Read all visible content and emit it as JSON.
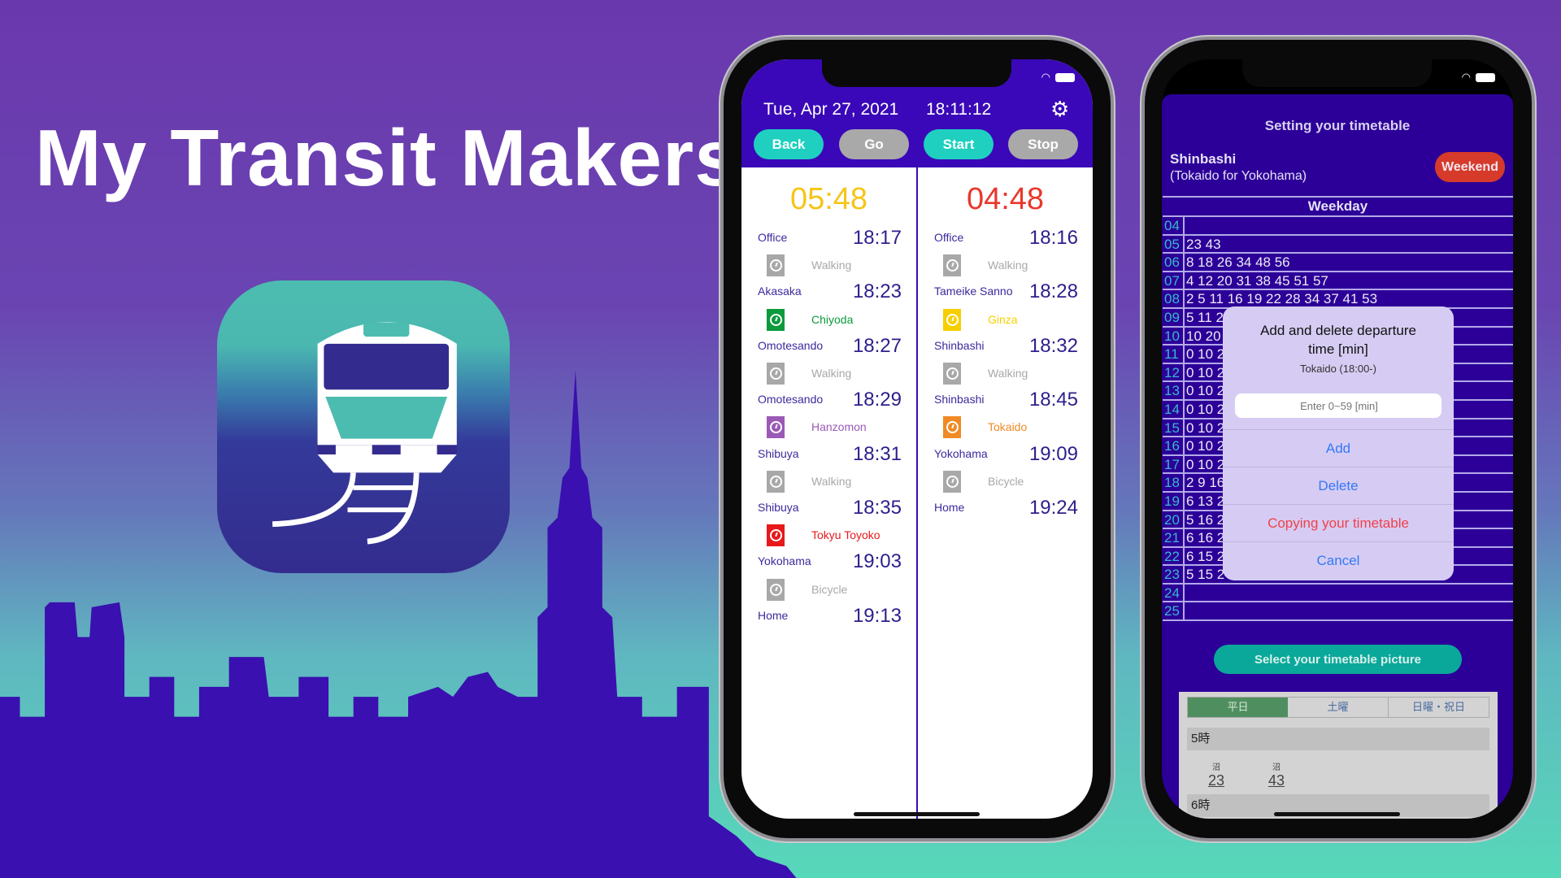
{
  "title": "My Transit Makers",
  "colors": {
    "skyline": "#3a10b0",
    "header_purple": "#3a08b8",
    "accent_teal": "#1fd0c0",
    "weekend_red": "#d63a2a"
  },
  "left_phone": {
    "date": "Tue, Apr 27, 2021",
    "clock": "18:11:12",
    "settings_icon": "gear-icon",
    "buttons": {
      "back": "Back",
      "go": "Go",
      "start": "Start",
      "stop": "Stop"
    },
    "columns": [
      {
        "countdown": "05:48",
        "countdown_color": "#f5c518",
        "items": [
          {
            "station": "Office",
            "time": "18:17"
          },
          {
            "mode": "Walking",
            "color": "#a8a8a8"
          },
          {
            "station": "Akasaka",
            "time": "18:23"
          },
          {
            "mode": "Chiyoda",
            "color": "#0b9a3c"
          },
          {
            "station": "Omotesando",
            "time": "18:27"
          },
          {
            "mode": "Walking",
            "color": "#a8a8a8"
          },
          {
            "station": "Omotesando",
            "time": "18:29"
          },
          {
            "mode": "Hanzomon",
            "color": "#9b59b6"
          },
          {
            "station": "Shibuya",
            "time": "18:31"
          },
          {
            "mode": "Walking",
            "color": "#a8a8a8"
          },
          {
            "station": "Shibuya",
            "time": "18:35"
          },
          {
            "mode": "Tokyu Toyoko",
            "color": "#e8191b"
          },
          {
            "station": "Yokohama",
            "time": "19:03"
          },
          {
            "mode": "Bicycle",
            "color": "#a8a8a8"
          },
          {
            "station": "Home",
            "time": "19:13"
          }
        ]
      },
      {
        "countdown": "04:48",
        "countdown_color": "#e8382c",
        "items": [
          {
            "station": "Office",
            "time": "18:16"
          },
          {
            "mode": "Walking",
            "color": "#a8a8a8"
          },
          {
            "station": "Tameike Sanno",
            "time": "18:28"
          },
          {
            "mode": "Ginza",
            "color": "#f7cf00"
          },
          {
            "station": "Shinbashi",
            "time": "18:32"
          },
          {
            "mode": "Walking",
            "color": "#a8a8a8"
          },
          {
            "station": "Shinbashi",
            "time": "18:45"
          },
          {
            "mode": "Tokaido",
            "color": "#f08a24"
          },
          {
            "station": "Yokohama",
            "time": "19:09"
          },
          {
            "mode": "Bicycle",
            "color": "#a8a8a8"
          },
          {
            "station": "Home",
            "time": "19:24"
          }
        ]
      }
    ]
  },
  "right_phone": {
    "heading": "Setting your timetable",
    "station": "Shinbashi",
    "line": "(Tokaido for Yokohama)",
    "weekend_button": "Weekend",
    "table_header": "Weekday",
    "rows": [
      {
        "hour": "04",
        "minutes": ""
      },
      {
        "hour": "05",
        "minutes": "23 43"
      },
      {
        "hour": "06",
        "minutes": "8 18 26 34 48 56"
      },
      {
        "hour": "07",
        "minutes": "4 12 20 31 38 45 51 57"
      },
      {
        "hour": "08",
        "minutes": "2 5 11 16 19 22 28 34 37 41 53"
      },
      {
        "hour": "09",
        "minutes": "5 11 2"
      },
      {
        "hour": "10",
        "minutes": "10 20"
      },
      {
        "hour": "11",
        "minutes": "0 10 2"
      },
      {
        "hour": "12",
        "minutes": "0 10 2"
      },
      {
        "hour": "13",
        "minutes": "0 10 2"
      },
      {
        "hour": "14",
        "minutes": "0 10 2"
      },
      {
        "hour": "15",
        "minutes": "0 10 2"
      },
      {
        "hour": "16",
        "minutes": "0 10 2"
      },
      {
        "hour": "17",
        "minutes": "0 10 2"
      },
      {
        "hour": "18",
        "minutes": "2 9 16"
      },
      {
        "hour": "19",
        "minutes": "6 13 2"
      },
      {
        "hour": "20",
        "minutes": "5 16 2"
      },
      {
        "hour": "21",
        "minutes": "6 16 2"
      },
      {
        "hour": "22",
        "minutes": "6 15 2"
      },
      {
        "hour": "23",
        "minutes": "5 15 2"
      },
      {
        "hour": "24",
        "minutes": ""
      },
      {
        "hour": "25",
        "minutes": ""
      }
    ],
    "dialog": {
      "title_line1": "Add and delete departure",
      "title_line2": "time [min]",
      "subtitle": "Tokaido (18:00-)",
      "input_placeholder": "Enter 0~59 [min]",
      "add": "Add",
      "delete": "Delete",
      "copy": "Copying your timetable",
      "cancel": "Cancel"
    },
    "select_picture_button": "Select your timetable picture",
    "picture": {
      "tabs": [
        "平日",
        "土曜",
        "日曜・祝日"
      ],
      "hour5": "5時",
      "entries": [
        {
          "mark": "沼",
          "minute": "23"
        },
        {
          "mark": "沼",
          "minute": "43"
        }
      ],
      "hour6": "6時"
    }
  }
}
